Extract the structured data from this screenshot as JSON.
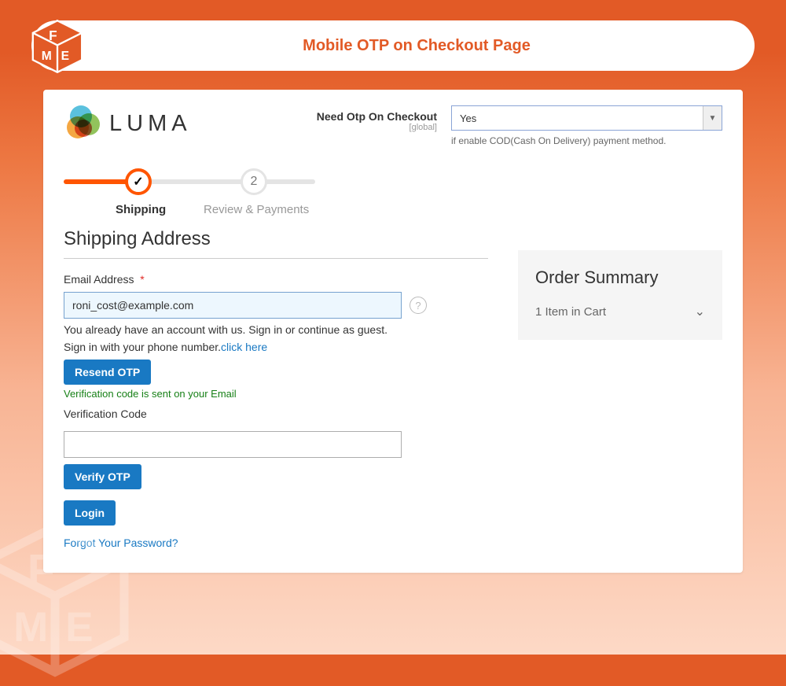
{
  "banner": {
    "title": "Mobile OTP on Checkout Page"
  },
  "brand": {
    "name": "LUMA"
  },
  "config": {
    "label": "Need Otp On Checkout",
    "scope": "[global]",
    "value": "Yes",
    "help": "if enable COD(Cash On Delivery) payment method."
  },
  "progress": {
    "step1_checkmark": "✓",
    "step1_label": "Shipping",
    "step2_number": "2",
    "step2_label": "Review & Payments"
  },
  "shipping": {
    "title": "Shipping Address",
    "email_label": "Email Address",
    "email_value": "roni_cost@example.com",
    "hint1": "You already have an account with us. Sign in or continue as guest.",
    "hint2_prefix": "Sign in with your phone number.",
    "hint2_link": "click here",
    "resend_btn": "Resend OTP",
    "sent_msg": "Verification code is sent on your Email",
    "code_label": "Verification Code",
    "verify_btn": "Verify OTP",
    "login_btn": "Login",
    "forgot": "Forgot Your Password?"
  },
  "summary": {
    "title": "Order Summary",
    "items_line": "1 Item in Cart"
  }
}
